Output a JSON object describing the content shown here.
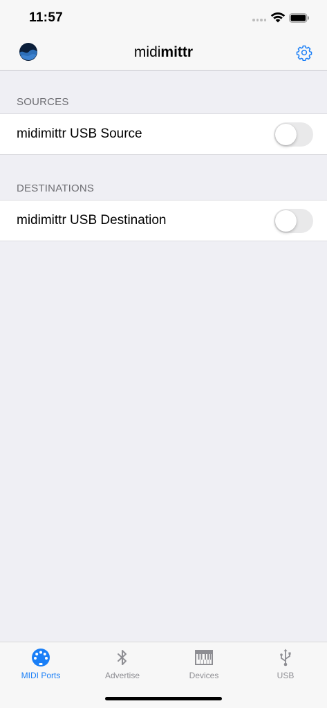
{
  "status_bar": {
    "time": "11:57"
  },
  "nav": {
    "title_light": "midi",
    "title_bold": "mittr"
  },
  "sections": {
    "sources": {
      "header": "SOURCES",
      "item_label": "midimittr USB Source",
      "enabled": false
    },
    "destinations": {
      "header": "DESTINATIONS",
      "item_label": "midimittr USB Destination",
      "enabled": false
    }
  },
  "tabs": [
    {
      "label": "MIDI Ports",
      "icon": "midi-port-icon",
      "active": true
    },
    {
      "label": "Advertise",
      "icon": "bluetooth-icon",
      "active": false
    },
    {
      "label": "Devices",
      "icon": "keyboard-icon",
      "active": false
    },
    {
      "label": "USB",
      "icon": "usb-icon",
      "active": false
    }
  ],
  "colors": {
    "accent": "#1a7ff7",
    "inactive": "#8e8e93",
    "background": "#efeff4"
  }
}
